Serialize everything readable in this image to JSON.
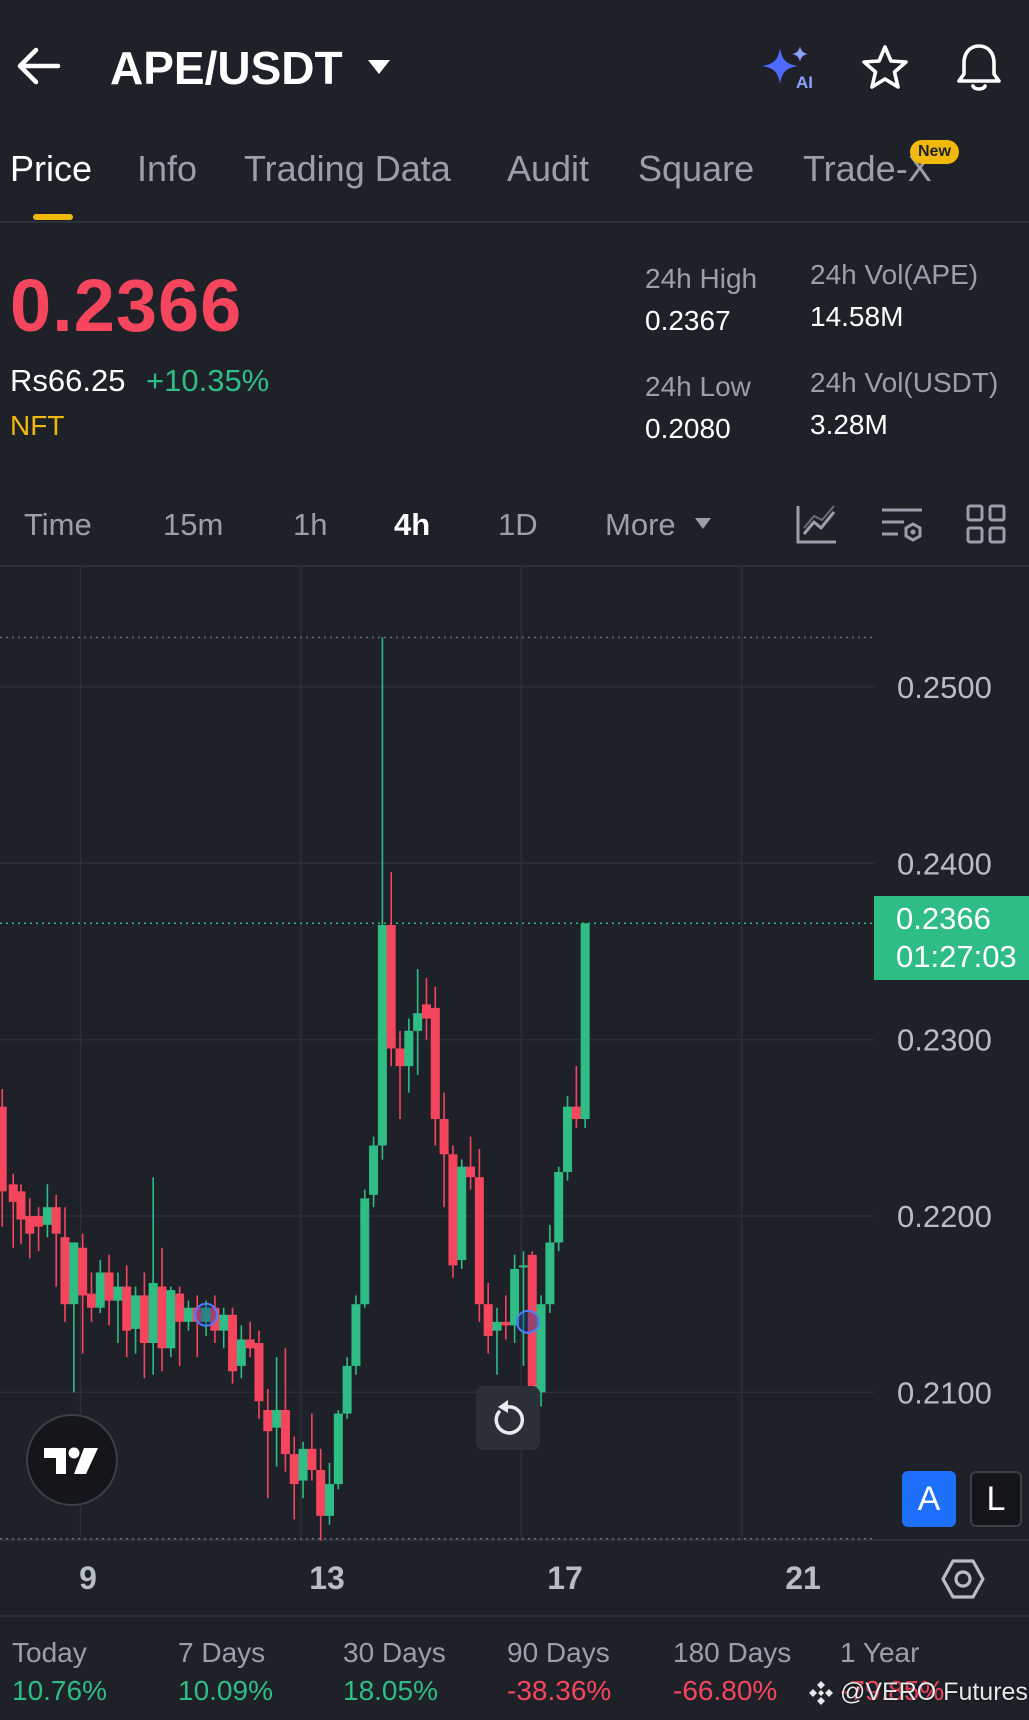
{
  "header": {
    "title": "APE/USDT",
    "icons": [
      "back-arrow-icon",
      "caret-down-icon",
      "ai-sparkle-icon",
      "star-icon",
      "bell-icon"
    ],
    "ai_text": "AI"
  },
  "tabs": [
    {
      "label": "Price",
      "active": true
    },
    {
      "label": "Info"
    },
    {
      "label": "Trading Data"
    },
    {
      "label": "Audit"
    },
    {
      "label": "Square"
    },
    {
      "label": "Trade-X",
      "badge": "New"
    }
  ],
  "price": {
    "last": "0.2366",
    "local": "Rs66.25",
    "change": "+10.35%",
    "tag": "NFT",
    "high_label": "24h High",
    "high_value": "0.2367",
    "low_label": "24h Low",
    "low_value": "0.2080",
    "vol_ape_label": "24h Vol(APE)",
    "vol_ape_value": "14.58M",
    "vol_usdt_label": "24h Vol(USDT)",
    "vol_usdt_value": "3.28M"
  },
  "intervals": {
    "items": [
      "Time",
      "15m",
      "1h",
      "4h",
      "1D",
      "More"
    ],
    "active": "4h",
    "tool_icons": [
      "indicator-icon",
      "chart-settings-icon",
      "layout-grid-icon"
    ]
  },
  "chart": {
    "current_price": "0.2366",
    "countdown": "01:27:03",
    "a_label": "A",
    "l_label": "L"
  },
  "colors": {
    "up": "#2ebd85",
    "down": "#f6465d",
    "accent": "#f0b90b",
    "bg": "#1e2128"
  },
  "chart_data": {
    "type": "candlestick",
    "title": "",
    "y_ticks": [
      "0.2500",
      "0.2400",
      "0.2300",
      "0.2200",
      "0.2100"
    ],
    "x_ticks": [
      "9",
      "13",
      "17",
      "21"
    ],
    "ylim": [
      0.2018,
      0.2568
    ],
    "xlim": [
      7.54,
      22.15
    ],
    "high_line": 0.2528,
    "low_line": 0.2017,
    "candles": [
      {
        "x": 7.58,
        "o": 0.2262,
        "h": 0.2272,
        "c": 0.2214,
        "l": 0.2194
      },
      {
        "x": 7.78,
        "o": 0.2218,
        "h": 0.2224,
        "c": 0.2208,
        "l": 0.2182
      },
      {
        "x": 7.92,
        "o": 0.2214,
        "h": 0.2218,
        "c": 0.2198,
        "l": 0.2184
      },
      {
        "x": 8.08,
        "o": 0.22,
        "h": 0.221,
        "c": 0.219,
        "l": 0.2176
      },
      {
        "x": 8.24,
        "o": 0.22,
        "h": 0.2205,
        "c": 0.2194,
        "l": 0.218
      },
      {
        "x": 8.4,
        "o": 0.2195,
        "h": 0.2218,
        "c": 0.2205,
        "l": 0.2188
      },
      {
        "x": 8.56,
        "o": 0.2205,
        "h": 0.2212,
        "c": 0.219,
        "l": 0.216
      },
      {
        "x": 8.72,
        "o": 0.2188,
        "h": 0.2205,
        "c": 0.215,
        "l": 0.214
      },
      {
        "x": 8.88,
        "o": 0.215,
        "h": 0.2175,
        "c": 0.2185,
        "l": 0.21
      },
      {
        "x": 9.04,
        "o": 0.2182,
        "h": 0.219,
        "c": 0.2155,
        "l": 0.2122
      },
      {
        "x": 9.2,
        "o": 0.2156,
        "h": 0.2168,
        "c": 0.2148,
        "l": 0.214
      },
      {
        "x": 9.36,
        "o": 0.2148,
        "h": 0.2175,
        "c": 0.2168,
        "l": 0.2145
      },
      {
        "x": 9.52,
        "o": 0.2168,
        "h": 0.2178,
        "c": 0.2152,
        "l": 0.2138
      },
      {
        "x": 9.68,
        "o": 0.2152,
        "h": 0.2168,
        "c": 0.216,
        "l": 0.2128
      },
      {
        "x": 9.84,
        "o": 0.216,
        "h": 0.2172,
        "c": 0.2135,
        "l": 0.212
      },
      {
        "x": 10.0,
        "o": 0.2136,
        "h": 0.216,
        "c": 0.2155,
        "l": 0.2122
      },
      {
        "x": 10.16,
        "o": 0.2155,
        "h": 0.2168,
        "c": 0.2128,
        "l": 0.2108
      },
      {
        "x": 10.32,
        "o": 0.2128,
        "h": 0.2222,
        "c": 0.2162,
        "l": 0.211
      },
      {
        "x": 10.48,
        "o": 0.216,
        "h": 0.2182,
        "c": 0.2125,
        "l": 0.2112
      },
      {
        "x": 10.64,
        "o": 0.2125,
        "h": 0.216,
        "c": 0.2158,
        "l": 0.212
      },
      {
        "x": 10.8,
        "o": 0.2156,
        "h": 0.216,
        "c": 0.214,
        "l": 0.2115
      },
      {
        "x": 10.96,
        "o": 0.214,
        "h": 0.2152,
        "c": 0.2148,
        "l": 0.2135
      },
      {
        "x": 11.12,
        "o": 0.2148,
        "h": 0.2155,
        "c": 0.214,
        "l": 0.212
      },
      {
        "x": 11.28,
        "o": 0.214,
        "h": 0.2152,
        "c": 0.2148,
        "l": 0.2132
      },
      {
        "x": 11.44,
        "o": 0.2148,
        "h": 0.2155,
        "c": 0.2135,
        "l": 0.2128
      },
      {
        "x": 11.6,
        "o": 0.2135,
        "h": 0.2148,
        "c": 0.2144,
        "l": 0.2125
      },
      {
        "x": 11.76,
        "o": 0.2144,
        "h": 0.2148,
        "c": 0.2112,
        "l": 0.2105
      },
      {
        "x": 11.92,
        "o": 0.2115,
        "h": 0.2138,
        "c": 0.213,
        "l": 0.2108
      },
      {
        "x": 12.08,
        "o": 0.213,
        "h": 0.214,
        "c": 0.2125,
        "l": 0.212
      },
      {
        "x": 12.24,
        "o": 0.2128,
        "h": 0.2135,
        "c": 0.2095,
        "l": 0.2085
      },
      {
        "x": 12.4,
        "o": 0.209,
        "h": 0.2102,
        "c": 0.2078,
        "l": 0.204
      },
      {
        "x": 12.56,
        "o": 0.208,
        "h": 0.212,
        "c": 0.209,
        "l": 0.2058
      },
      {
        "x": 12.72,
        "o": 0.209,
        "h": 0.2125,
        "c": 0.2065,
        "l": 0.2055
      },
      {
        "x": 12.88,
        "o": 0.2065,
        "h": 0.2075,
        "c": 0.2048,
        "l": 0.2028
      },
      {
        "x": 13.04,
        "o": 0.205,
        "h": 0.2072,
        "c": 0.2068,
        "l": 0.204
      },
      {
        "x": 13.2,
        "o": 0.2068,
        "h": 0.2088,
        "c": 0.2056,
        "l": 0.205
      },
      {
        "x": 13.36,
        "o": 0.2056,
        "h": 0.2068,
        "c": 0.203,
        "l": 0.2016
      },
      {
        "x": 13.52,
        "o": 0.203,
        "h": 0.206,
        "c": 0.2048,
        "l": 0.2025
      },
      {
        "x": 13.68,
        "o": 0.2048,
        "h": 0.209,
        "c": 0.2088,
        "l": 0.2045
      },
      {
        "x": 13.84,
        "o": 0.2088,
        "h": 0.212,
        "c": 0.2115,
        "l": 0.2085
      },
      {
        "x": 14.0,
        "o": 0.2115,
        "h": 0.2155,
        "c": 0.215,
        "l": 0.211
      },
      {
        "x": 14.16,
        "o": 0.215,
        "h": 0.2215,
        "c": 0.221,
        "l": 0.2148
      },
      {
        "x": 14.32,
        "o": 0.2212,
        "h": 0.2245,
        "c": 0.224,
        "l": 0.2205
      },
      {
        "x": 14.48,
        "o": 0.224,
        "h": 0.2528,
        "c": 0.2365,
        "l": 0.2232
      },
      {
        "x": 14.64,
        "o": 0.2365,
        "h": 0.2395,
        "c": 0.2295,
        "l": 0.2285
      },
      {
        "x": 14.8,
        "o": 0.2295,
        "h": 0.2305,
        "c": 0.2285,
        "l": 0.2255
      },
      {
        "x": 14.96,
        "o": 0.2285,
        "h": 0.2312,
        "c": 0.2305,
        "l": 0.227
      },
      {
        "x": 15.12,
        "o": 0.2305,
        "h": 0.234,
        "c": 0.2315,
        "l": 0.228
      },
      {
        "x": 15.28,
        "o": 0.232,
        "h": 0.2335,
        "c": 0.2312,
        "l": 0.23
      },
      {
        "x": 15.44,
        "o": 0.2318,
        "h": 0.233,
        "c": 0.2255,
        "l": 0.224
      },
      {
        "x": 15.6,
        "o": 0.2255,
        "h": 0.227,
        "c": 0.2235,
        "l": 0.2205
      },
      {
        "x": 15.76,
        "o": 0.2235,
        "h": 0.224,
        "c": 0.2172,
        "l": 0.2165
      },
      {
        "x": 15.92,
        "o": 0.2175,
        "h": 0.2232,
        "c": 0.2228,
        "l": 0.217
      },
      {
        "x": 16.08,
        "o": 0.2228,
        "h": 0.2245,
        "c": 0.2222,
        "l": 0.2215
      },
      {
        "x": 16.24,
        "o": 0.2222,
        "h": 0.2238,
        "c": 0.215,
        "l": 0.214
      },
      {
        "x": 16.4,
        "o": 0.215,
        "h": 0.2162,
        "c": 0.2132,
        "l": 0.2122
      },
      {
        "x": 16.56,
        "o": 0.2135,
        "h": 0.2148,
        "c": 0.214,
        "l": 0.211
      },
      {
        "x": 16.72,
        "o": 0.214,
        "h": 0.2155,
        "c": 0.2138,
        "l": 0.213
      },
      {
        "x": 16.88,
        "o": 0.2138,
        "h": 0.2178,
        "c": 0.217,
        "l": 0.2128
      },
      {
        "x": 17.04,
        "o": 0.2172,
        "h": 0.218,
        "c": 0.2172,
        "l": 0.2115
      },
      {
        "x": 17.2,
        "o": 0.2178,
        "h": 0.218,
        "c": 0.2102,
        "l": 0.2082
      },
      {
        "x": 17.36,
        "o": 0.21,
        "h": 0.2155,
        "c": 0.215,
        "l": 0.2092
      },
      {
        "x": 17.52,
        "o": 0.215,
        "h": 0.2195,
        "c": 0.2185,
        "l": 0.2145
      },
      {
        "x": 17.68,
        "o": 0.2185,
        "h": 0.2228,
        "c": 0.2225,
        "l": 0.218
      },
      {
        "x": 17.84,
        "o": 0.2225,
        "h": 0.2268,
        "c": 0.2262,
        "l": 0.222
      },
      {
        "x": 18.0,
        "o": 0.2262,
        "h": 0.2285,
        "c": 0.2255,
        "l": 0.225
      },
      {
        "x": 18.16,
        "o": 0.2255,
        "h": 0.2366,
        "c": 0.2366,
        "l": 0.225
      }
    ],
    "markers": [
      11.28,
      17.12
    ]
  },
  "timeline": {
    "settings_icon": "settings-hexagon-icon"
  },
  "performance": [
    {
      "label": "Today",
      "value": "10.76%",
      "dir": "up"
    },
    {
      "label": "7 Days",
      "value": "10.09%",
      "dir": "up"
    },
    {
      "label": "30 Days",
      "value": "18.05%",
      "dir": "up"
    },
    {
      "label": "90 Days",
      "value": "-38.36%",
      "dir": "down"
    },
    {
      "label": "180 Days",
      "value": "-66.80%",
      "dir": "down"
    },
    {
      "label": "1 Year",
      "value": "-79.85%",
      "dir": "down"
    }
  ],
  "watermark": "@VERO Futures"
}
